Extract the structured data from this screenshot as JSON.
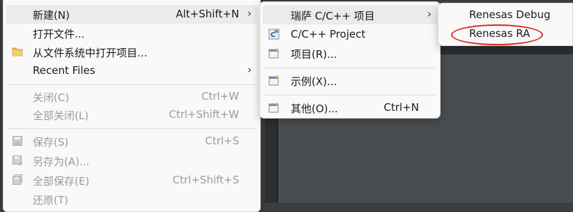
{
  "file_menu": {
    "items": [
      {
        "label": "新建(N)",
        "accel": "Alt+Shift+N",
        "submenu": true
      },
      {
        "label": "打开文件..."
      },
      {
        "label": "从文件系统中打开项目...",
        "icon": "folder-icon"
      },
      {
        "label": "Recent Files",
        "submenu": true
      },
      {
        "label": "关闭(C)",
        "accel": "Ctrl+W"
      },
      {
        "label": "全部关闭(L)",
        "accel": "Ctrl+Shift+W"
      },
      {
        "label": "保存(S)",
        "accel": "Ctrl+S",
        "icon": "save-icon"
      },
      {
        "label": "另存为(A)...",
        "icon": "save-as-icon"
      },
      {
        "label": "全部保存(E)",
        "accel": "Ctrl+Shift+S",
        "icon": "save-all-icon"
      },
      {
        "label": "还原(T)"
      }
    ]
  },
  "new_submenu": {
    "items": [
      {
        "label": "瑞萨 C/C++ 项目",
        "submenu": true
      },
      {
        "label": "C/C++ Project",
        "icon": "cpp-project-icon"
      },
      {
        "label": "项目(R)...",
        "icon": "new-project-icon"
      },
      {
        "label": "示例(X)...",
        "icon": "example-icon"
      },
      {
        "label": "其他(O)...",
        "accel": "Ctrl+N",
        "icon": "other-wizard-icon"
      }
    ],
    "arrow": "›"
  },
  "renesas_submenu": {
    "items": [
      {
        "label": "Renesas Debug"
      },
      {
        "label": "Renesas RA"
      }
    ]
  },
  "arrow_glyph": "›",
  "colors": {
    "highlight_circle": "#e0241b",
    "menu_bg": "#f9f9f9",
    "disabled_text": "#9a9a9a"
  }
}
